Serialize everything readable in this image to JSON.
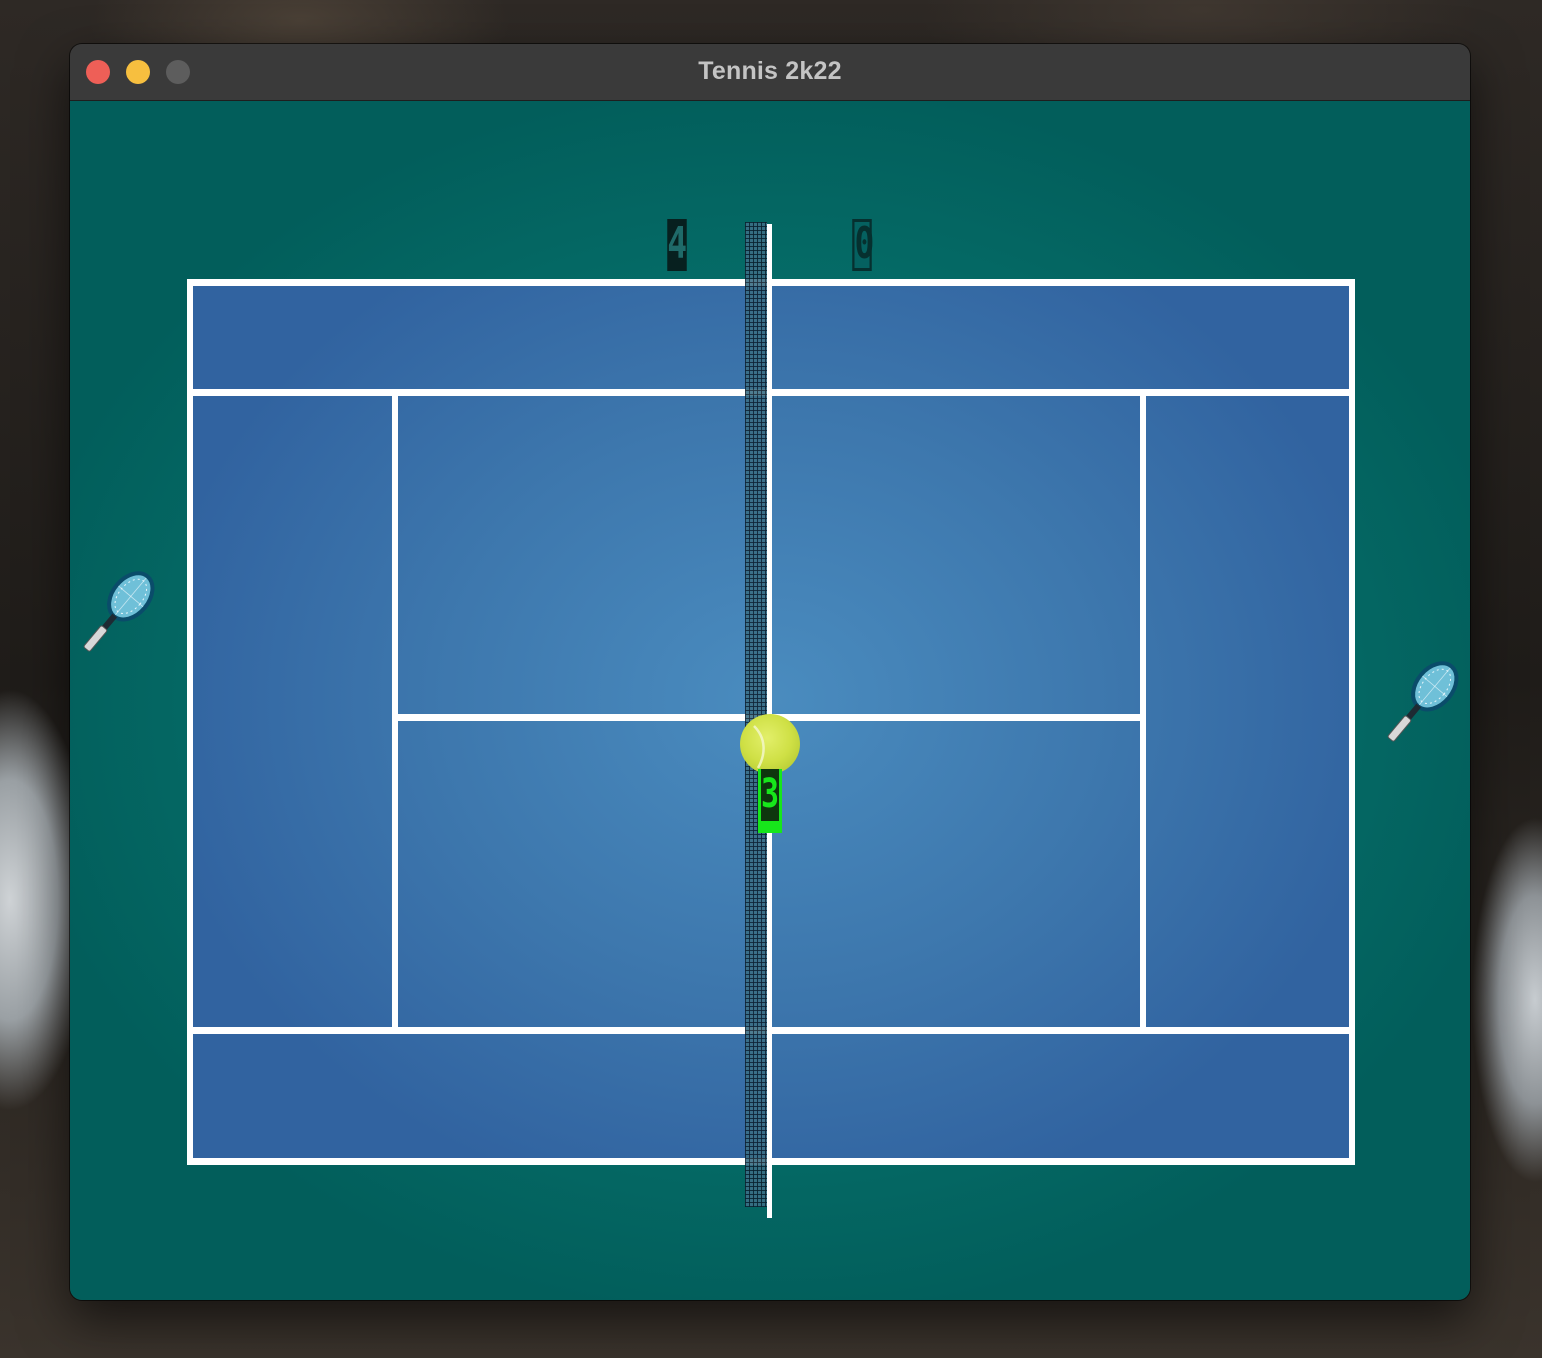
{
  "window": {
    "title": "Tennis 2k22"
  },
  "scoreboard": {
    "left_score": "4",
    "right_score": "0",
    "rally_count": "3"
  },
  "colors": {
    "background_teal": "#06706b",
    "court_blue": "#3d77ad",
    "court_lines": "#ffffff",
    "ball": "#cfe045",
    "rally_badge": "#17e61b"
  },
  "icons": {
    "left_paddle": "tennis-racket-icon",
    "right_paddle": "tennis-racket-icon",
    "ball": "tennis-ball-icon"
  }
}
